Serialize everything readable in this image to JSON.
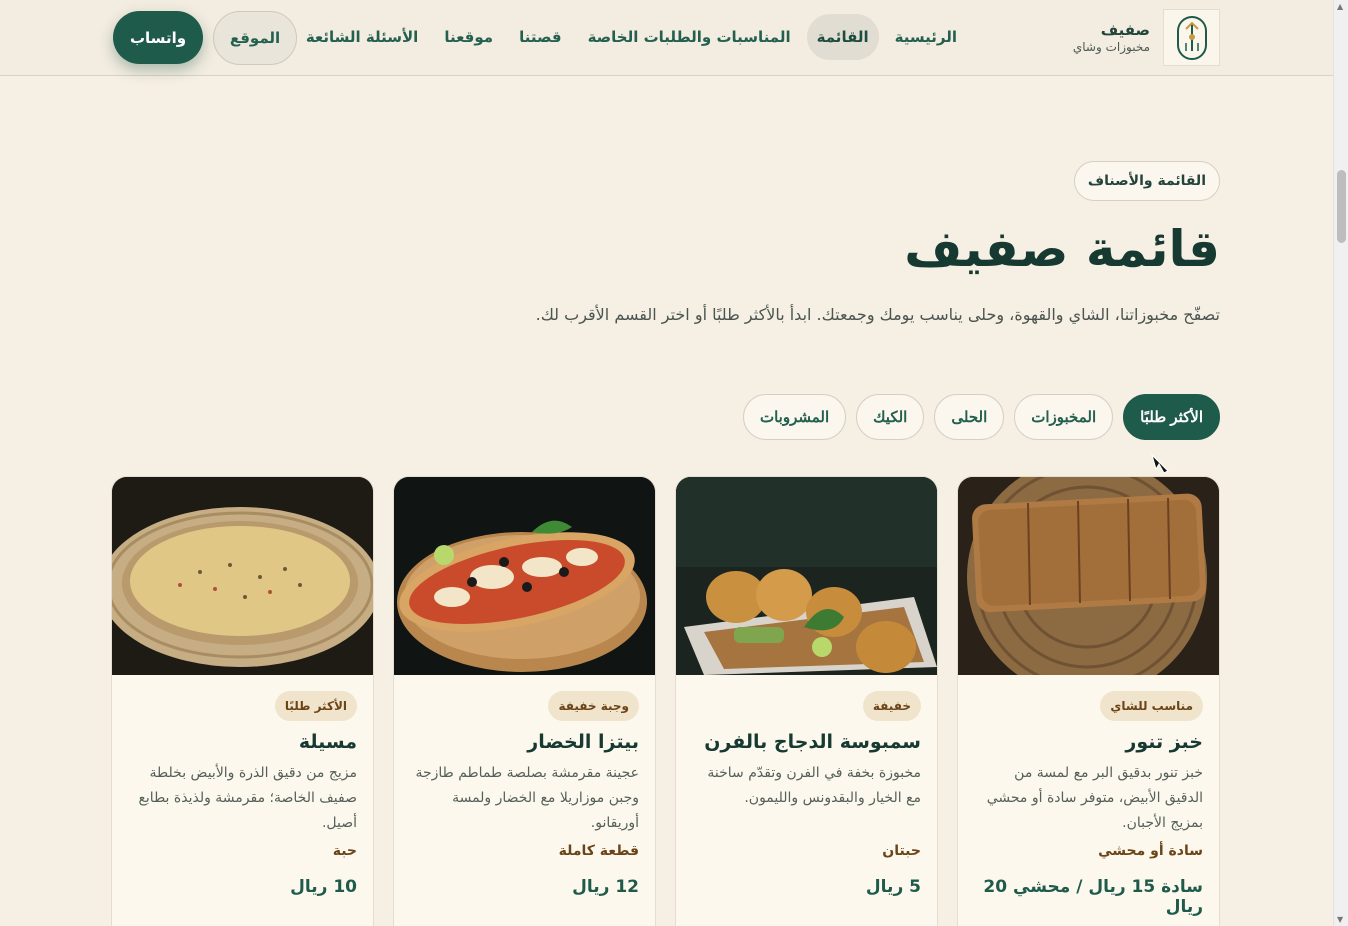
{
  "brand": {
    "name": "صفيف",
    "subtitle": "مخبوزات وشاي"
  },
  "nav": {
    "items": [
      {
        "label": "الرئيسية",
        "active": false
      },
      {
        "label": "القائمة",
        "active": true
      },
      {
        "label": "المناسبات والطلبات الخاصة",
        "active": false
      },
      {
        "label": "قصتنا",
        "active": false
      },
      {
        "label": "موقعنا",
        "active": false
      },
      {
        "label": "الأسئلة الشائعة",
        "active": false
      }
    ]
  },
  "actions": {
    "location_label": "الموقع",
    "whatsapp_label": "واتساب"
  },
  "hero": {
    "eyebrow": "القائمة والأصناف",
    "title": "قائمة صفيف",
    "description": "تصفّح مخبوزاتنا، الشاي والقهوة، وحلى يناسب يومك وجمعتك. ابدأ بالأكثر طلبًا أو اختر القسم الأقرب لك."
  },
  "filters": [
    {
      "label": "الأكثر طلبًا",
      "active": true
    },
    {
      "label": "المخبوزات",
      "active": false
    },
    {
      "label": "الحلى",
      "active": false
    },
    {
      "label": "الكيك",
      "active": false
    },
    {
      "label": "المشروبات",
      "active": false
    }
  ],
  "products": [
    {
      "badge": "مناسب للشاي",
      "title": "خبز تنور",
      "description": "خبز تنور بدقيق البر مع لمسة من الدقيق الأبيض، متوفر سادة أو محشي بمزيج الأجبان.",
      "unit": "سادة أو محشي",
      "price": "سادة 15 ريال / محشي 20 ريال",
      "image": "tannour-bread"
    },
    {
      "badge": "خفيفة",
      "title": "سمبوسة الدجاج بالفرن",
      "description": "مخبوزة بخفة في الفرن وتقدّم ساخنة مع الخيار والبقدونس والليمون.",
      "unit": "حبتان",
      "price": "5 ريال",
      "image": "baked-chicken-samosa"
    },
    {
      "badge": "وجبة خفيفة",
      "title": "بيتزا الخضار",
      "description": "عجينة مقرمشة بصلصة طماطم طازجة وجبن موزاريلا مع الخضار ولمسة أوريقانو.",
      "unit": "قطعة كاملة",
      "price": "12 ريال",
      "image": "vegetable-pizza"
    },
    {
      "badge": "الأكثر طلبًا",
      "title": "مسيلة",
      "description": "مزيج من دقيق الذرة والأبيض بخلطة صفيف الخاصة؛ مقرمشة ولذيذة بطابع أصيل.",
      "unit": "حبة",
      "price": "10 ريال",
      "image": "masila-bread"
    }
  ],
  "colors": {
    "primary": "#1f5b4b",
    "background": "#f6efe3",
    "badge_bg": "#f1e4cc",
    "badge_text": "#6b4417"
  }
}
